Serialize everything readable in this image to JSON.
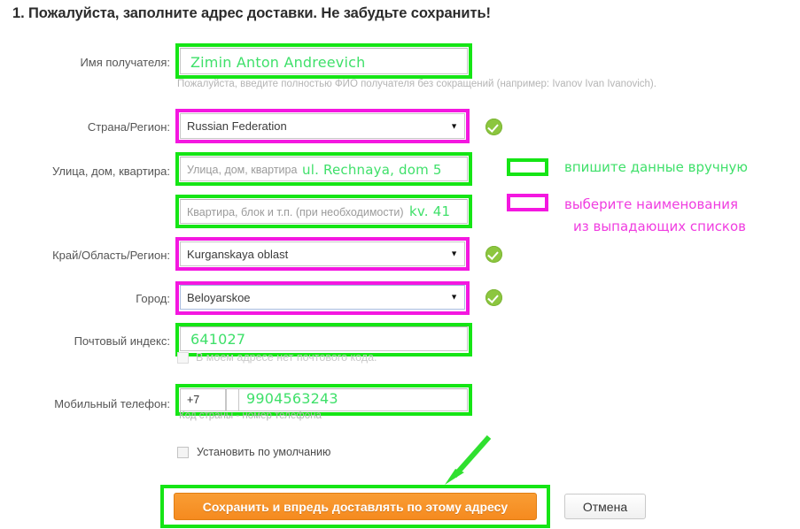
{
  "heading": "1. Пожалуйста, заполните адрес доставки. Не забудьте сохранить!",
  "colors": {
    "highlight_manual": "#15e515",
    "highlight_dropdown": "#f417e0",
    "valid_badge": "#8cc63f",
    "save_button": "#f58a1f",
    "annotation_green": "#3fe06a",
    "annotation_pink": "#f03de0"
  },
  "fields": {
    "recipient": {
      "label": "Имя получателя:",
      "value": "Zimin Anton Andreevich",
      "hint": "Пожалуйста, введите полностью ФИО получателя без сокращений (например: Ivanov Ivan Ivanovich).",
      "highlight": "green"
    },
    "country": {
      "label": "Страна/Регион:",
      "value": "Russian Federation",
      "caret": "▼",
      "highlight": "pink",
      "valid": true
    },
    "street": {
      "label": "Улица, дом, квартира:",
      "placeholder": "Улица, дом, квартира",
      "value": "ul. Rechnaya, dom 5",
      "highlight": "green"
    },
    "apartment": {
      "label": "",
      "placeholder": "Квартира, блок и т.п. (при необходимости)",
      "value": "kv. 41",
      "highlight": "green"
    },
    "region": {
      "label": "Край/Область/Регион:",
      "value": "Kurganskaya oblast",
      "caret": "▼",
      "highlight": "pink",
      "valid": true
    },
    "city": {
      "label": "Город:",
      "value": "Beloyarskoe",
      "caret": "▼",
      "highlight": "pink",
      "valid": true
    },
    "postcode": {
      "label": "Почтовый индекс:",
      "value": "641027",
      "highlight": "green",
      "no_postcode_checkbox_label": "В моем адресе нет почтового кода.",
      "no_postcode_checked": false
    },
    "phone": {
      "label": "Мобильный телефон:",
      "country_code": "+7",
      "area_code": "",
      "number": "9904563243",
      "hint": "Код страны - номер телефона",
      "highlight": "green"
    }
  },
  "default_checkbox": {
    "label": "Установить по умолчанию",
    "checked": false
  },
  "legend": [
    {
      "swatch": "green",
      "text": "впишите данные вручную"
    },
    {
      "swatch": "pink",
      "text_line1": "выберите наименования",
      "text_line2": "из выпадающих списков"
    }
  ],
  "buttons": {
    "save": "Сохранить и впредь доставлять по этому адресу",
    "cancel": "Отмена"
  }
}
